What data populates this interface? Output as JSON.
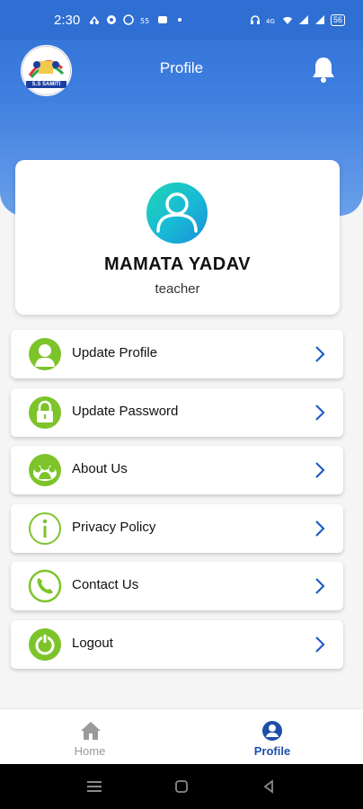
{
  "status_bar": {
    "time": "2:30",
    "battery": "56"
  },
  "header": {
    "title": "Profile",
    "logo_text": "S.S SAMITI"
  },
  "profile": {
    "name": "MAMATA YADAV",
    "role": "teacher"
  },
  "menu": {
    "items": [
      {
        "label": "Update Profile",
        "icon": "user-icon"
      },
      {
        "label": "Update Password",
        "icon": "lock-icon"
      },
      {
        "label": "About Us",
        "icon": "group-icon"
      },
      {
        "label": "Privacy Policy",
        "icon": "info-icon"
      },
      {
        "label": "Contact Us",
        "icon": "phone-icon"
      },
      {
        "label": "Logout",
        "icon": "power-icon"
      }
    ]
  },
  "bottom_nav": {
    "home_label": "Home",
    "profile_label": "Profile"
  },
  "colors": {
    "primary_blue": "#2f6fd3",
    "icon_green": "#7cc42a",
    "chevron_blue": "#1e5ec8",
    "active_tab": "#1e4fa8"
  }
}
